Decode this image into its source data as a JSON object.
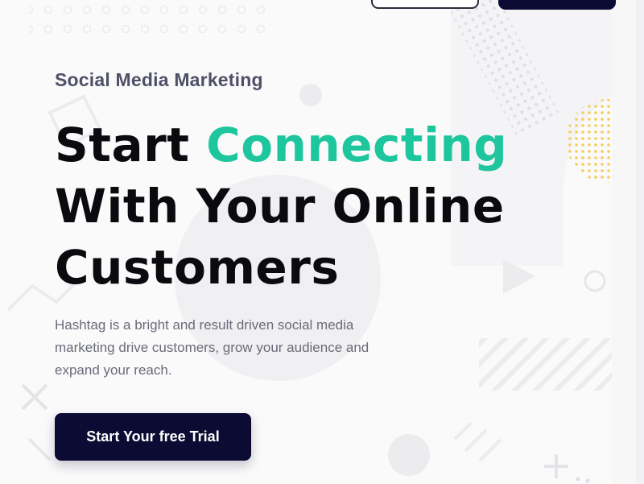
{
  "hero": {
    "eyebrow": "Social Media Marketing",
    "headline": {
      "line1_prefix": "Start ",
      "line1_accent": "Connecting",
      "line2": "With Your Online",
      "line3": "Customers"
    },
    "description": "Hashtag is a bright and result driven social media marketing drive customers, grow your audience and expand your reach.",
    "cta_label": "Start Your free Trial"
  },
  "colors": {
    "accent": "#1ec69e",
    "primary_dark": "#0c0b33",
    "heading": "#0a0a0f",
    "eyebrow": "#4f5068",
    "body_text": "#6a6b7a",
    "dots_yellow": "#f7cc5d"
  }
}
